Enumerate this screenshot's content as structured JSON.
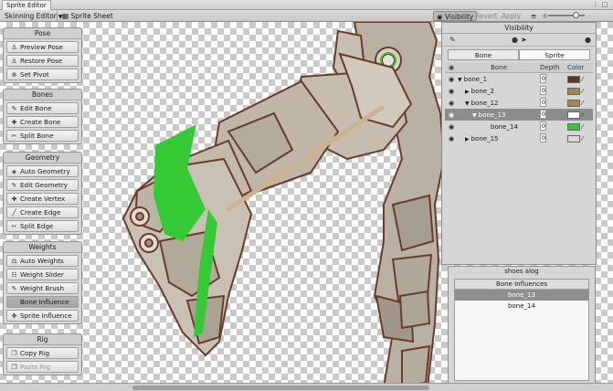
{
  "window": {
    "title": "Sprite Editor"
  },
  "toolbar": {
    "mode": "Skinning Editor",
    "sprite_sheet": "Sprite Sheet",
    "visibility": "Visibility",
    "revert": "Revert",
    "apply": "Apply"
  },
  "tool_groups": [
    {
      "title": "Pose",
      "buttons": [
        {
          "label": "Preview Pose",
          "icon": "person-icon",
          "active": false,
          "disabled": false
        },
        {
          "label": "Restore Pose",
          "icon": "person-icon",
          "active": false,
          "disabled": false
        },
        {
          "label": "Set Pivot",
          "icon": "pivot-icon",
          "active": false,
          "disabled": false
        }
      ]
    },
    {
      "title": "Bones",
      "buttons": [
        {
          "label": "Edit Bone",
          "icon": "bone-icon",
          "active": false,
          "disabled": false
        },
        {
          "label": "Create Bone",
          "icon": "bone-icon",
          "active": false,
          "disabled": false
        },
        {
          "label": "Split Bone",
          "icon": "bone-icon",
          "active": false,
          "disabled": false
        }
      ]
    },
    {
      "title": "Geometry",
      "buttons": [
        {
          "label": "Auto Geometry",
          "icon": "geometry-icon",
          "active": false,
          "disabled": false
        },
        {
          "label": "Edit Geometry",
          "icon": "geometry-icon",
          "active": false,
          "disabled": false
        },
        {
          "label": "Create Vertex",
          "icon": "vertex-icon",
          "active": false,
          "disabled": false
        },
        {
          "label": "Create Edge",
          "icon": "edge-icon",
          "active": false,
          "disabled": false
        },
        {
          "label": "Split Edge",
          "icon": "edge-icon",
          "active": false,
          "disabled": false
        }
      ]
    },
    {
      "title": "Weights",
      "buttons": [
        {
          "label": "Auto Weights",
          "icon": "weights-icon",
          "active": false,
          "disabled": false
        },
        {
          "label": "Weight Slider",
          "icon": "slider-icon",
          "active": false,
          "disabled": false
        },
        {
          "label": "Weight Brush",
          "icon": "brush-icon",
          "active": false,
          "disabled": false
        },
        {
          "label": "Bone Influence",
          "icon": "",
          "active": true,
          "disabled": false
        },
        {
          "label": "Sprite Influence",
          "icon": "influence-icon",
          "active": false,
          "disabled": false
        }
      ]
    },
    {
      "title": "Rig",
      "buttons": [
        {
          "label": "Copy Rig",
          "icon": "copy-icon",
          "active": false,
          "disabled": false
        },
        {
          "label": "Paste Rig",
          "icon": "paste-icon",
          "active": false,
          "disabled": true
        }
      ]
    }
  ],
  "visibility_panel": {
    "title": "Visibility",
    "tabs": [
      "Bone",
      "Sprite"
    ],
    "active_tab": "Bone",
    "columns": [
      "Bone",
      "Depth",
      "Color"
    ],
    "rows": [
      {
        "name": "bone_1",
        "indent": 0,
        "expanded": true,
        "depth": "0",
        "color": "#5a3b22",
        "selected": false
      },
      {
        "name": "bone_2",
        "indent": 1,
        "expanded": false,
        "depth": "0",
        "color": "#a08850",
        "selected": false
      },
      {
        "name": "bone_12",
        "indent": 1,
        "expanded": true,
        "depth": "0",
        "color": "#a08850",
        "selected": false
      },
      {
        "name": "bone_13",
        "indent": 2,
        "expanded": true,
        "depth": "0",
        "color": "#ffffff",
        "selected": true
      },
      {
        "name": "bone_14",
        "indent": 3,
        "expanded": null,
        "depth": "0",
        "color": "#3cc23c",
        "selected": false
      },
      {
        "name": "bone_15",
        "indent": 1,
        "expanded": false,
        "depth": "0",
        "color": "#d8d8d8",
        "selected": false
      }
    ]
  },
  "influence_panel": {
    "sprite_name": "shoes alog",
    "header": "Bone Influences",
    "items": [
      {
        "name": "bone_13",
        "selected": true
      },
      {
        "name": "bone_14",
        "selected": false
      }
    ]
  }
}
